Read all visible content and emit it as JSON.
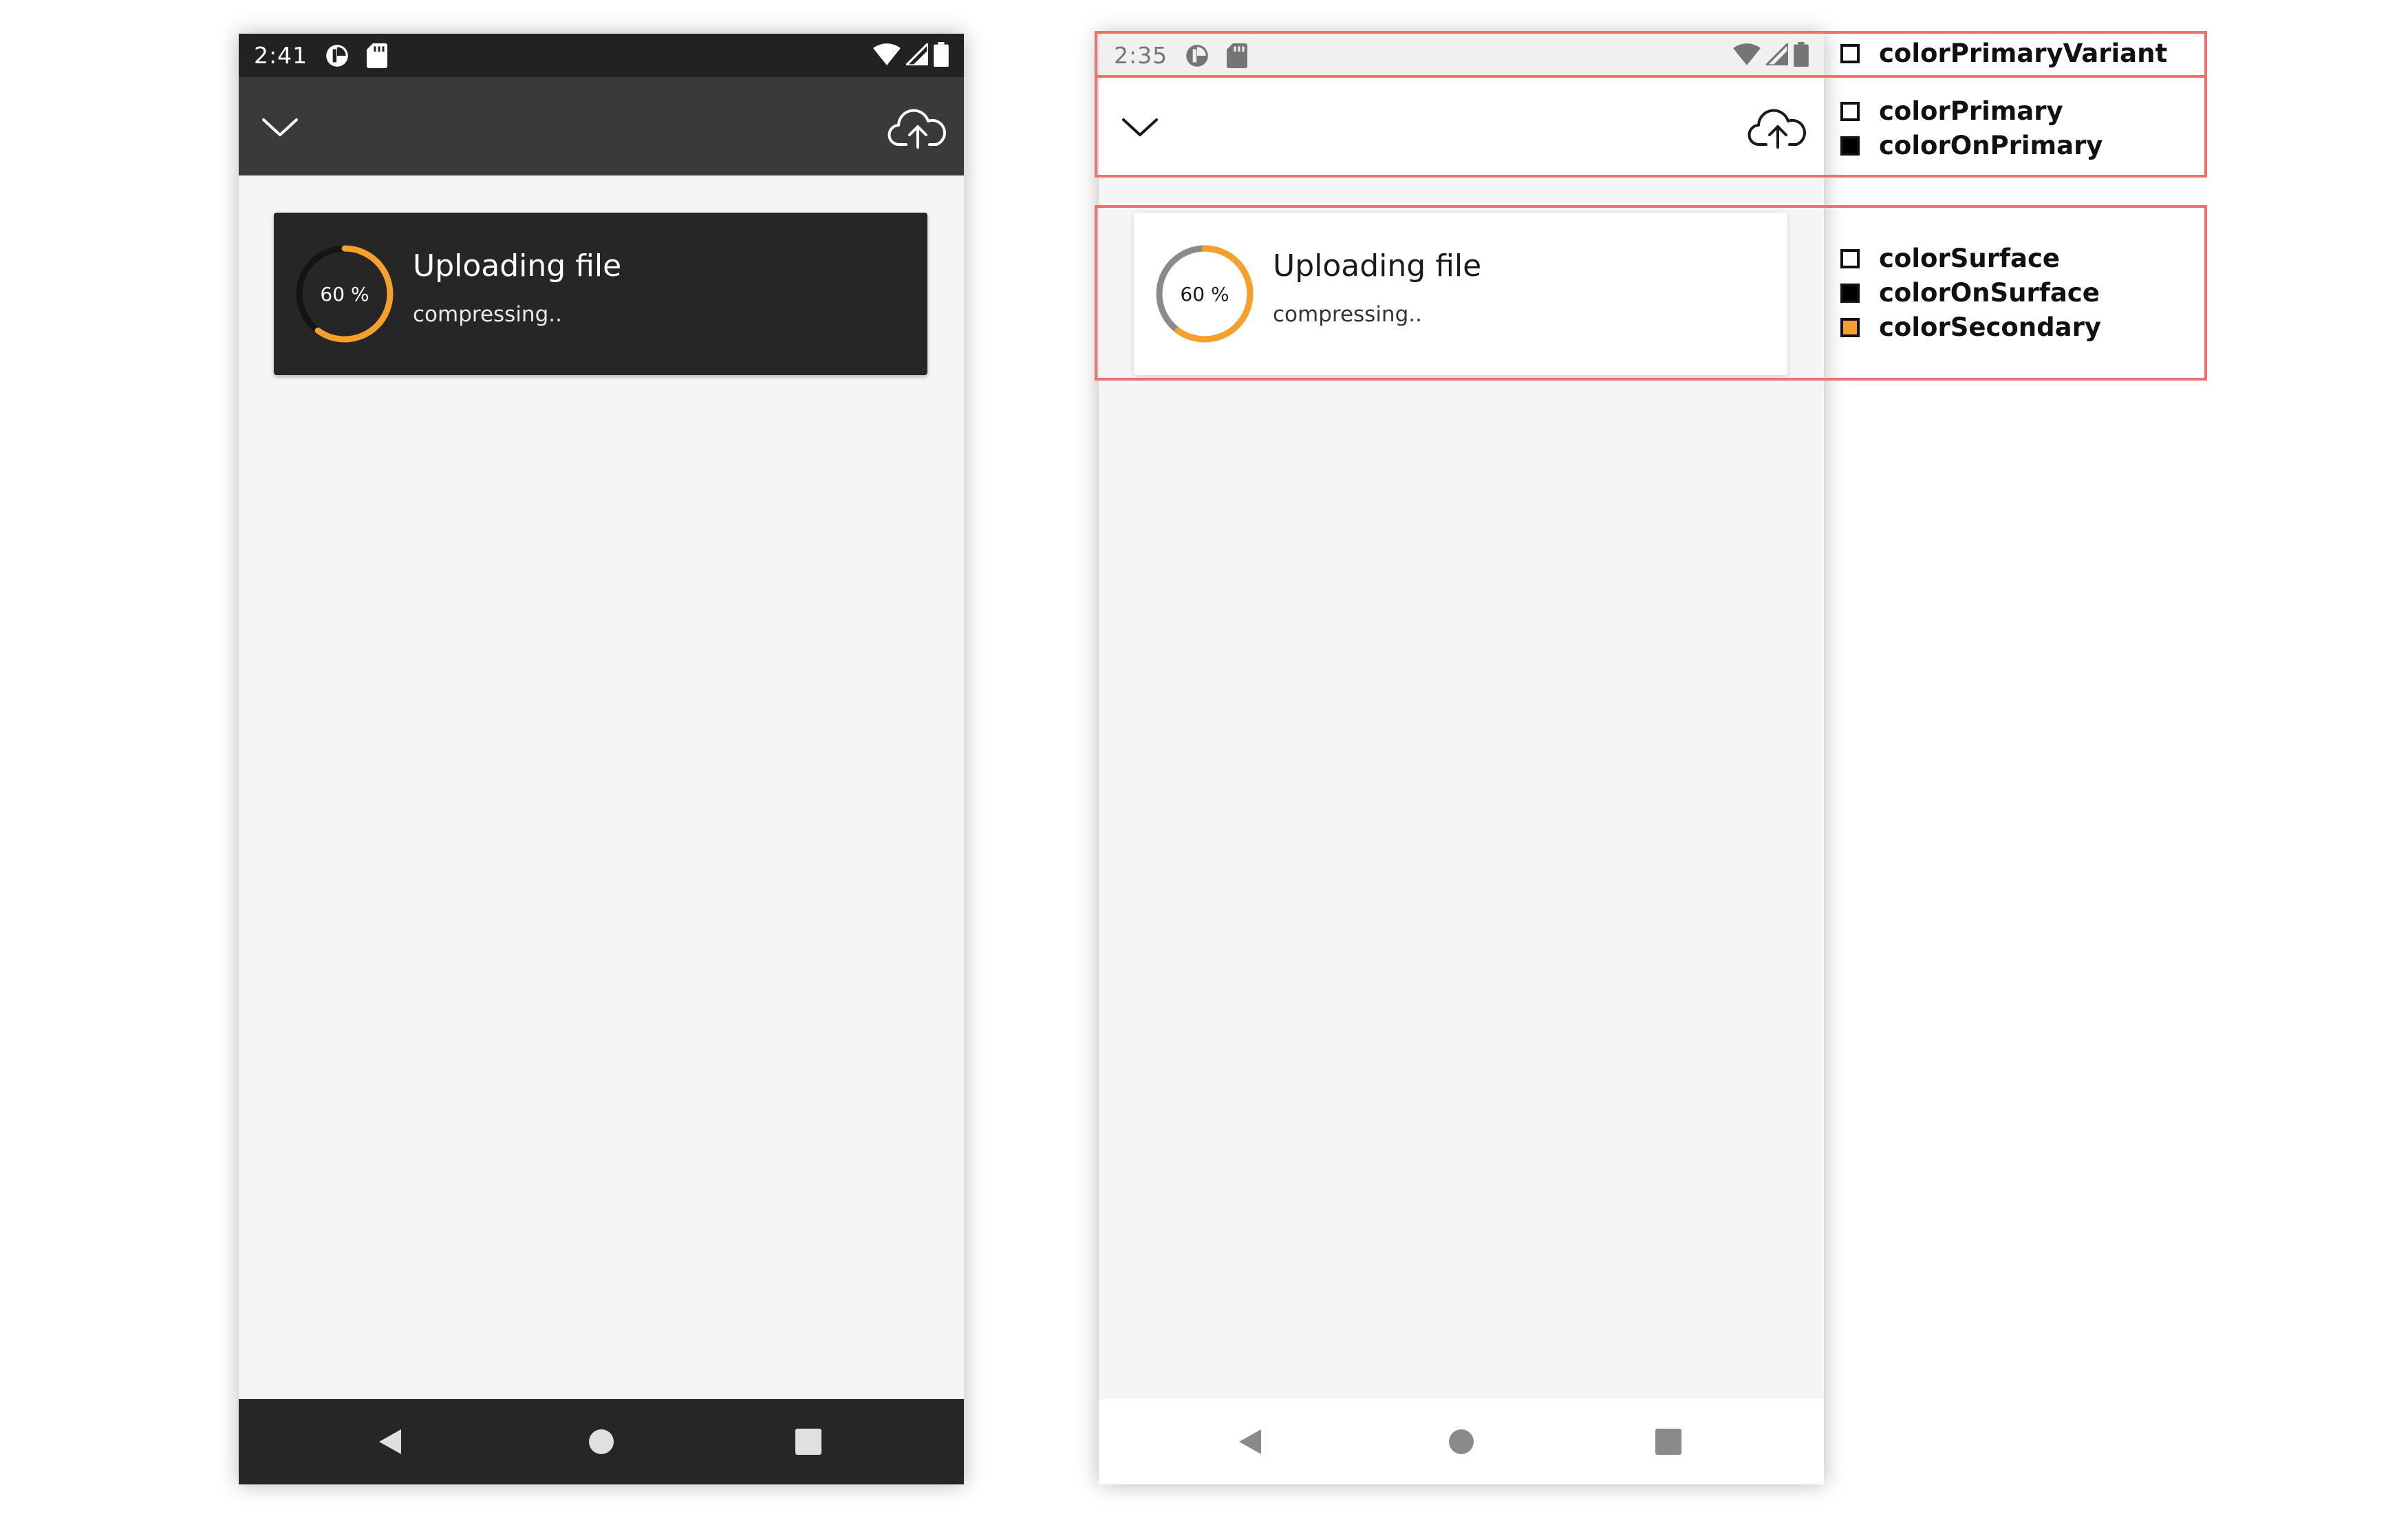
{
  "colors": {
    "dark_status_bar": "#222222",
    "dark_toolbar": "#3a3a3a",
    "dark_surface": "#262626",
    "light_status_bar": "#f0f0f0",
    "light_surface": "#ffffff",
    "background": "#f5f5f5",
    "secondary": "#f4a02c",
    "highlight_border": "#f07070"
  },
  "dark_phone": {
    "status_bar": {
      "time": "2:41",
      "left_icons": [
        "data-saver-icon",
        "sd-card-icon"
      ],
      "right_icons": [
        "wifi-icon",
        "cellular-signal-icon",
        "battery-icon"
      ]
    },
    "toolbar": {
      "left_icon": "chevron-down-icon",
      "right_icon": "cloud-upload-icon"
    },
    "card": {
      "progress_percent": 60,
      "progress_label": "60 %",
      "title": "Uploading file",
      "subtitle": "compressing.."
    },
    "nav_bar": [
      "back-icon",
      "home-icon",
      "recents-icon"
    ]
  },
  "light_phone": {
    "status_bar": {
      "time": "2:35",
      "left_icons": [
        "data-saver-icon",
        "sd-card-icon"
      ],
      "right_icons": [
        "wifi-icon",
        "cellular-signal-icon",
        "battery-icon"
      ]
    },
    "toolbar": {
      "left_icon": "chevron-down-icon",
      "right_icon": "cloud-upload-icon"
    },
    "card": {
      "progress_percent": 60,
      "progress_label": "60 %",
      "title": "Uploading file",
      "subtitle": "compressing.."
    },
    "nav_bar": [
      "back-icon",
      "home-icon",
      "recents-icon"
    ]
  },
  "legend": {
    "status_bar_group": [
      {
        "label": "colorPrimaryVariant",
        "swatch": "#ffffff"
      }
    ],
    "toolbar_group": [
      {
        "label": "colorPrimary",
        "swatch": "#ffffff"
      },
      {
        "label": "colorOnPrimary",
        "swatch": "#000000"
      }
    ],
    "card_group": [
      {
        "label": "colorSurface",
        "swatch": "#ffffff"
      },
      {
        "label": "colorOnSurface",
        "swatch": "#000000"
      },
      {
        "label": "colorSecondary",
        "swatch": "#f4a02c"
      }
    ]
  }
}
